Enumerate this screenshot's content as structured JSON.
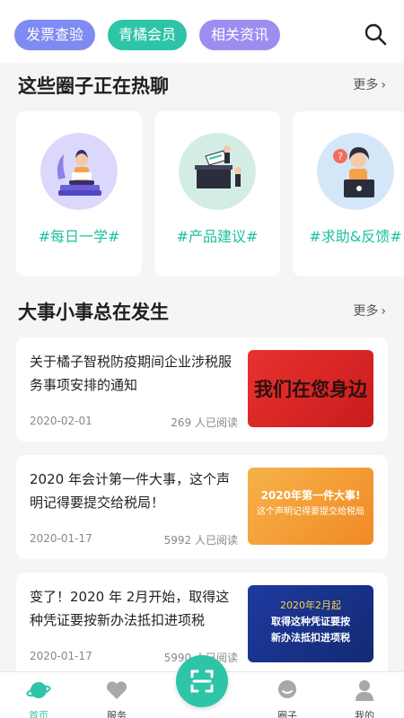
{
  "top_tabs": [
    {
      "label": "发票查验",
      "color": "#7d8bf2"
    },
    {
      "label": "青橘会员",
      "color": "#2ec4a8"
    },
    {
      "label": "相关资讯",
      "color": "#9c8ef0"
    }
  ],
  "search_icon": "search-icon",
  "circles_section": {
    "title": "这些圈子正在热聊",
    "more": "更多",
    "cards": [
      {
        "tag": "#每日一学#"
      },
      {
        "tag": "#产品建议#"
      },
      {
        "tag": "#求助&反馈#"
      }
    ]
  },
  "news_section": {
    "title": "大事小事总在发生",
    "more": "更多",
    "items": [
      {
        "title": "关于橘子智税防疫期间企业涉税服务事项安排的通知",
        "date": "2020-02-01",
        "reads": "269 人已阅读",
        "thumb_text": "我们在您身边"
      },
      {
        "title": "2020 年会计第一件大事，这个声明记得要提交给税局！",
        "date": "2020-01-17",
        "reads": "5992 人已阅读",
        "thumb_line1": "2020年第一件大事!",
        "thumb_line2": "这个声明记得要提交给税局"
      },
      {
        "title": "变了！2020 年 2月开始，取得这种凭证要按新办法抵扣进项税",
        "date": "2020-01-17",
        "reads": "5990 人已阅读",
        "thumb_line1": "2020年2月起",
        "thumb_line2": "取得这种凭证要按",
        "thumb_line3": "新办法抵扣进项税"
      }
    ]
  },
  "bottom_nav": [
    {
      "label": "首页",
      "icon": "planet-icon",
      "active": true
    },
    {
      "label": "服务",
      "icon": "heart-icon"
    },
    {
      "label": "圈子",
      "icon": "chat-icon"
    },
    {
      "label": "我的",
      "icon": "person-icon"
    }
  ],
  "scan_button_icon": "scan-icon",
  "colors": {
    "accent": "#2ec4a8",
    "background": "#f5f5f5"
  }
}
